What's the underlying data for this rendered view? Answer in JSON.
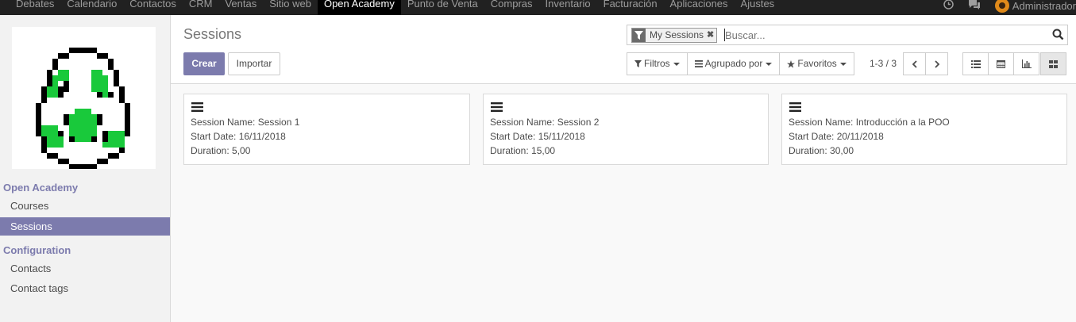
{
  "topnav": {
    "menu": [
      "Debates",
      "Calendario",
      "Contactos",
      "CRM",
      "Ventas",
      "Sitio web",
      "Open Academy",
      "Punto de Venta",
      "Compras",
      "Inventario",
      "Facturación",
      "Aplicaciones",
      "Ajustes"
    ],
    "active_index": 6,
    "user": "Administrador",
    "icons": [
      "clock-icon",
      "chat-icon",
      "avatar"
    ]
  },
  "sidebar": {
    "section1": "Open Academy",
    "items1": [
      {
        "label": "Courses",
        "active": false
      },
      {
        "label": "Sessions",
        "active": true
      }
    ],
    "section2": "Configuration",
    "items2": [
      {
        "label": "Contacts",
        "active": false
      },
      {
        "label": "Contact tags",
        "active": false
      }
    ]
  },
  "control_panel": {
    "title": "Sessions",
    "create_label": "Crear",
    "import_label": "Importar",
    "search": {
      "facet_label": "My Sessions",
      "placeholder": "Buscar..."
    },
    "filters_label": "Filtros",
    "group_label": "Agrupado por",
    "favorites_label": "Favoritos",
    "pager": "1-3 / 3",
    "views": [
      "list-view-icon",
      "calendar-view-icon",
      "graph-view-icon",
      "kanban-view-icon"
    ],
    "active_view": "kanban-view-icon"
  },
  "kanban": {
    "cards": [
      {
        "name": "Session Name: Session 1",
        "start": "Start Date: 16/11/2018",
        "duration": "Duration: 5,00"
      },
      {
        "name": "Session Name: Session 2",
        "start": "Start Date: 15/11/2018",
        "duration": "Duration: 15,00"
      },
      {
        "name": "Session Name: Introducción a la POO",
        "start": "Start Date: 20/11/2018",
        "duration": "Duration: 30,00"
      }
    ]
  },
  "colors": {
    "accent": "#7c7bad",
    "topnav_bg": "#212121",
    "logo_green": "#19c93b"
  }
}
